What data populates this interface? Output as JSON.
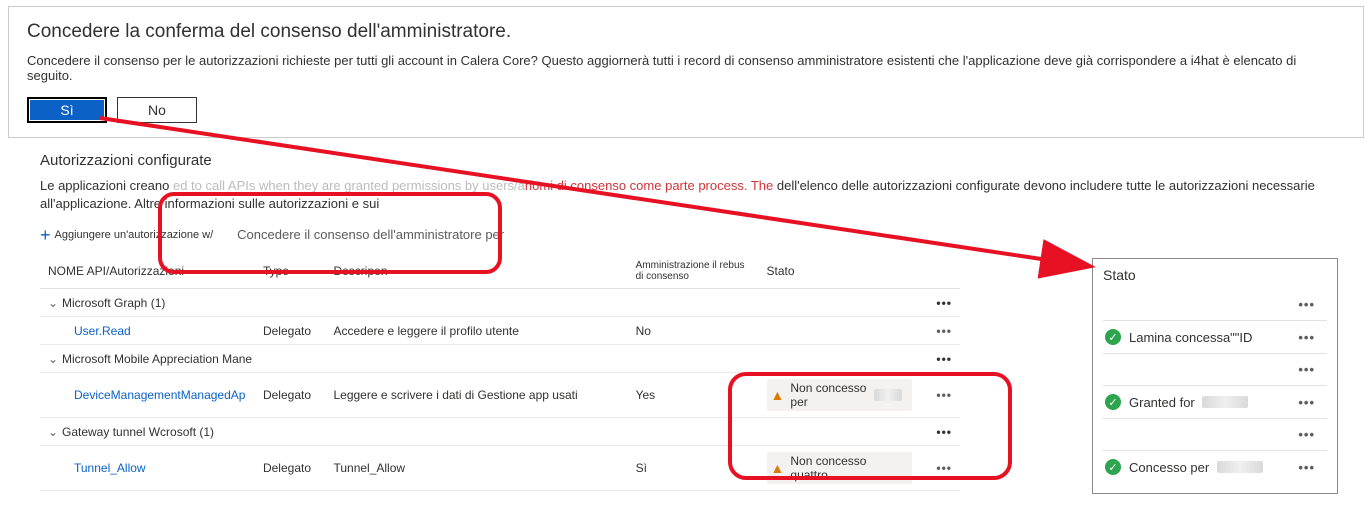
{
  "dialog": {
    "title": "Concedere la conferma del consenso dell'amministratore.",
    "text": "Concedere il consenso per le autorizzazioni richieste per tutti gli account in Calera Core? Questo aggiornerà tutti i record di consenso amministratore esistenti che l'applicazione deve già corrispondere a i4hat è elencato di seguito.",
    "yes": "Sì",
    "no": "No"
  },
  "section": {
    "title": "Autorizzazioni configurate",
    "desc_pre": "Le applicazioni creano ",
    "desc_faded": "ed to call APIs when they are granted permissions by users/a",
    "desc_red": "nomi di consenso come parte process. The ",
    "desc_post": "dell'elenco delle autorizzazioni configurate devono includere tutte le autorizzazioni necessarie all'applicazione. Altre informazioni sulle autorizzazioni e sui"
  },
  "toolbar": {
    "add": "Aggiungere un'autorizzazione w/",
    "grant": "Concedere il consenso dell'amministratore per"
  },
  "table": {
    "headers": {
      "name": "NOME API/Autorizzazioni",
      "type": "Type",
      "desc": "Descripen",
      "admin": "Amministrazione il rebus di consenso",
      "status": "Stato"
    },
    "groups": [
      {
        "label": "Microsoft Graph (1)"
      },
      {
        "label": "Microsoft Mobile Appreciation Mane"
      },
      {
        "label": "Gateway tunnel Wcrosoft (1)"
      }
    ],
    "rows": [
      {
        "name": "User.Read",
        "type": "Delegato",
        "desc": "Accedere e leggere il profilo utente",
        "admin": "No",
        "status": ""
      },
      {
        "name": "DeviceManagementManagedAp",
        "type": "Delegato",
        "desc": "Leggere e scrivere i dati di Gestione app usati",
        "admin": "Yes",
        "status": "Non concesso per"
      },
      {
        "name": "Tunnel_Allow",
        "type": "Delegato",
        "desc": "Tunnel_Allow",
        "admin": "Sì",
        "status": "Non concesso quattro"
      }
    ]
  },
  "status_card": {
    "title": "Stato",
    "rows": [
      {
        "text": "Lamina concessa\"\"ID"
      },
      {
        "text": "Granted for"
      },
      {
        "text": "Concesso per"
      }
    ]
  },
  "glyphs": {
    "ellipsis": "•••",
    "check": "✓",
    "warn": "▲",
    "chev": "⌄"
  }
}
